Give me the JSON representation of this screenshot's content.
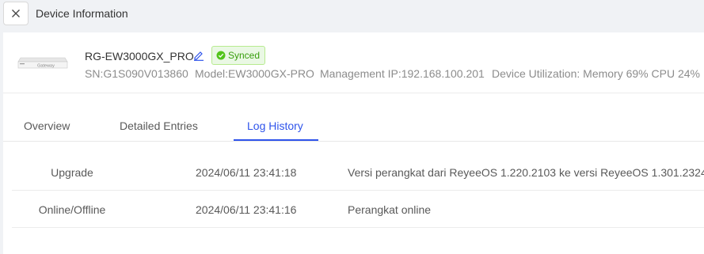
{
  "header": {
    "title": "Device Information"
  },
  "device": {
    "image_label": "Gateway",
    "name": "RG-EW3000GX_PRO",
    "status": "Synced",
    "sn": "SN:G1S090V013860",
    "model": "Model:EW3000GX-PRO",
    "management_ip": "Management IP:192.168.100.201",
    "utilization": "Device Utilization: Memory 69% CPU 24%"
  },
  "tabs": [
    {
      "label": "Overview",
      "active": false
    },
    {
      "label": "Detailed Entries",
      "active": false
    },
    {
      "label": "Log History",
      "active": true
    }
  ],
  "logs": [
    {
      "type": "Upgrade",
      "time": "2024/06/11 23:41:18",
      "description": "Versi perangkat dari ReyeeOS 1.220.2103 ke versi ReyeeOS 1.301.2324"
    },
    {
      "type": "Online/Offline",
      "time": "2024/06/11 23:41:16",
      "description": "Perangkat online"
    }
  ],
  "colors": {
    "accent": "#2f54eb",
    "status_green": "#52c41a",
    "background": "#f0f2f5"
  },
  "icons": {
    "close": "close-icon",
    "edit": "edit-icon",
    "status": "check-circle-icon"
  }
}
